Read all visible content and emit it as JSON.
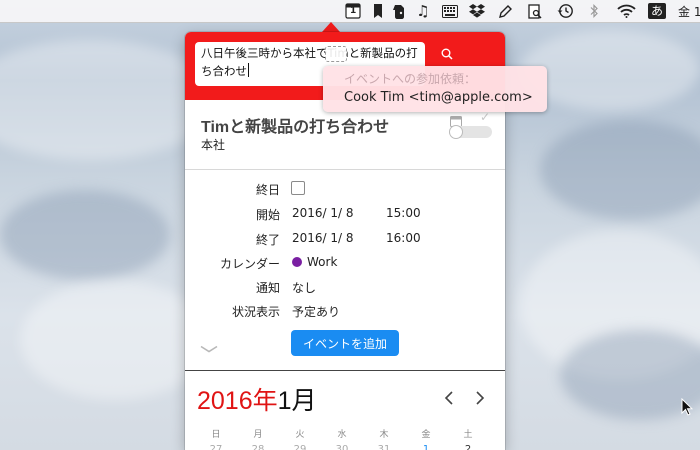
{
  "menubar": {
    "calendar_icon_day": "1",
    "input_source_label": "あ",
    "clock_text": "金 1"
  },
  "search": {
    "query": "八日午後三時から本社でTimと新製品の打ち合わせ"
  },
  "tooltip": {
    "heading": "イベントへの参加依頼：",
    "invitee": "Cook Tim <tim@apple.com>"
  },
  "event": {
    "title": "Timと新製品の打ち合わせ",
    "location": "本社"
  },
  "fields": {
    "all_day_label": "終日",
    "start_label": "開始",
    "start_date": "2016/  1/  8",
    "start_time": "15:00",
    "end_label": "終了",
    "end_date": "2016/  1/  8",
    "end_time": "16:00",
    "calendar_label": "カレンダー",
    "calendar_value": "Work",
    "calendar_color": "#7a1fa2",
    "alert_label": "通知",
    "alert_value": "なし",
    "availability_label": "状況表示",
    "availability_value": "予定あり"
  },
  "add_button_label": "イベントを追加",
  "calendar_view": {
    "year_label": "2016年",
    "month_label": "1月",
    "weekdays": [
      "日",
      "月",
      "火",
      "水",
      "木",
      "金",
      "土"
    ],
    "first_row_dates": [
      "27",
      "28",
      "29",
      "30",
      "31",
      "1",
      "2"
    ]
  },
  "colors": {
    "header_red": "#f21b1b",
    "button_blue": "#1a8cf2",
    "year_red": "#e01414"
  }
}
